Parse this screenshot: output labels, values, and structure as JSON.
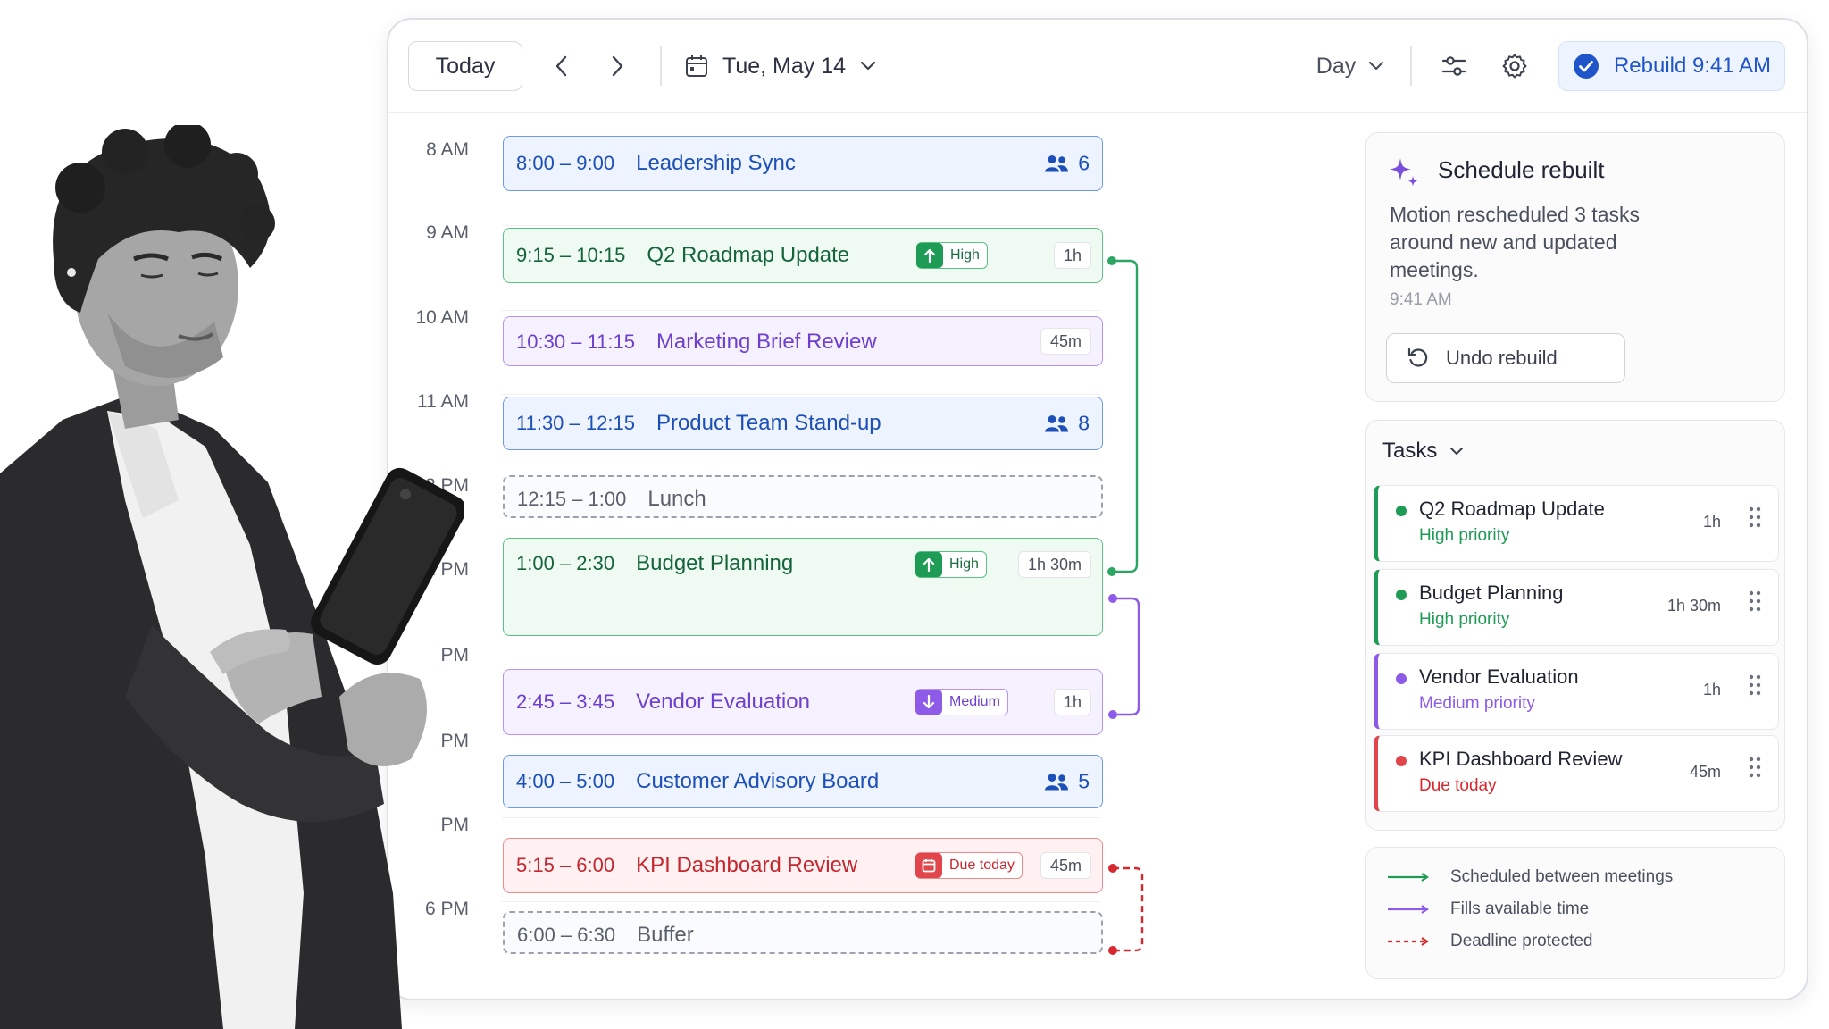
{
  "toolbar": {
    "today_label": "Today",
    "date_label": "Tue, May 14",
    "view_label": "Day",
    "rebuild_label": "Rebuild 9:41 AM"
  },
  "hours": [
    "8 AM",
    "9 AM",
    "10 AM",
    "11 AM",
    "12 PM",
    "1 PM",
    "PM",
    "PM",
    "PM",
    "6 PM"
  ],
  "events": {
    "leadership": {
      "time": "8:00 – 9:00",
      "name": "Leadership Sync",
      "attendees": "6"
    },
    "roadmap": {
      "time": "9:15 – 10:15",
      "name": "Q2 Roadmap Update",
      "badge": "High",
      "duration": "1h"
    },
    "marketing": {
      "time": "10:30 – 11:15",
      "name": "Marketing Brief Review",
      "duration": "45m"
    },
    "standup": {
      "time": "11:30 – 12:15",
      "name": "Product Team Stand-up",
      "attendees": "8"
    },
    "lunch": {
      "time": "12:15 – 1:00",
      "name": "Lunch"
    },
    "budget": {
      "time": "1:00 – 2:30",
      "name": "Budget Planning",
      "badge": "High",
      "duration": "1h 30m"
    },
    "vendor": {
      "time": "2:45 – 3:45",
      "name": "Vendor Evaluation",
      "badge": "Medium",
      "duration": "1h"
    },
    "advisory": {
      "time": "4:00 – 5:00",
      "name": "Customer Advisory Board",
      "attendees": "5"
    },
    "kpi": {
      "time": "5:15 – 6:00",
      "name": "KPI Dashboard Review",
      "badge": "Due today",
      "duration": "45m"
    },
    "buffer": {
      "time": "6:00 – 6:30",
      "name": "Buffer"
    }
  },
  "rebuilt_card": {
    "title": "Schedule rebuilt",
    "body": "Motion rescheduled 3 tasks around new and updated meetings.",
    "time": "9:41 AM",
    "undo_label": "Undo rebuild"
  },
  "tasks": {
    "header": "Tasks",
    "items": [
      {
        "name": "Q2 Roadmap Update",
        "priority": "High priority",
        "duration": "1h"
      },
      {
        "name": "Budget Planning",
        "priority": "High priority",
        "duration": "1h 30m"
      },
      {
        "name": "Vendor Evaluation",
        "priority": "Medium priority",
        "duration": "1h"
      },
      {
        "name": "KPI Dashboard Review",
        "priority": "Due today",
        "duration": "45m"
      }
    ]
  },
  "legend": {
    "items": [
      "Scheduled between meetings",
      "Fills available time",
      "Deadline protected"
    ]
  },
  "colors": {
    "accent_blue": "#1f55c8",
    "green": "#1e9b55",
    "purple": "#8d5be8",
    "red": "#e0464b"
  }
}
